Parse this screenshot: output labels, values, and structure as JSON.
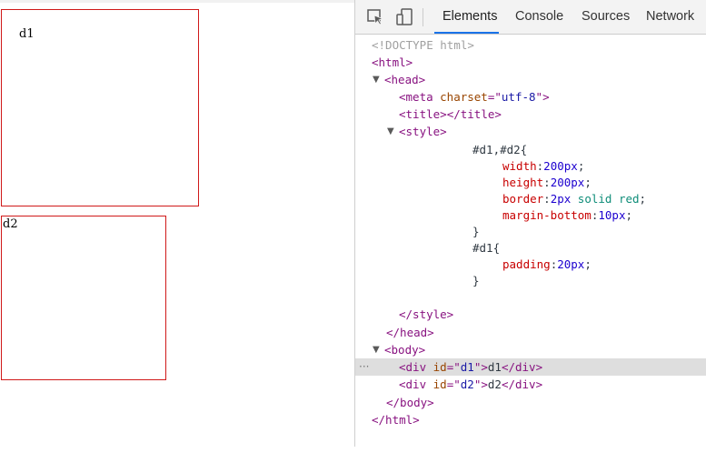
{
  "page": {
    "d1_text": "d1",
    "d2_text": "d2"
  },
  "devtools": {
    "icons": [
      "inspect-element-icon",
      "device-toolbar-icon"
    ],
    "tabs": [
      "Elements",
      "Console",
      "Sources",
      "Network"
    ],
    "active_tab": "Elements",
    "dom": {
      "doctype": "<!DOCTYPE html>",
      "html_open": "<html>",
      "head_open": "<head>",
      "meta_open": "<meta ",
      "meta_attr": "charset",
      "meta_eq": "=\"",
      "meta_val": "utf-8",
      "meta_close": "\">",
      "title_open": "<title>",
      "title_close": "</title>",
      "style_open": "<style>",
      "css_sel1": "#d1,#d2{",
      "css_width_prop": "width",
      "css_width_val": "200px",
      "css_height_prop": "height",
      "css_height_val": "200px",
      "css_border_prop": "border",
      "css_border_num": "2px",
      "css_border_rest": "solid red",
      "css_mb_prop": "margin-bottom",
      "css_mb_val": "10px",
      "css_close": "}",
      "css_sel2": "#d1{",
      "css_pad_prop": "padding",
      "css_pad_val": "20px",
      "colon": ":",
      "semi": ";",
      "style_close": "</style>",
      "head_close": "</head>",
      "body_open": "<body>",
      "div_open": "<div ",
      "div_attr": "id",
      "div_eq": "=\"",
      "div1_val": "d1",
      "div2_val": "d2",
      "div_gt": "\">",
      "div1_text": "d1",
      "div2_text": "d2",
      "div_close": "</div>",
      "body_close": "</body>",
      "html_close": "</html>",
      "ellipsis": "···"
    }
  },
  "colors": {
    "box_border": "#d01919",
    "tag": "#881280",
    "attr": "#994500",
    "attr_value": "#1a1aa6",
    "css_property": "#c80000",
    "css_number": "#1c00cf",
    "css_keyword": "#0f8d79",
    "tab_underline": "#1a73e8",
    "selected_row": "#dedede"
  }
}
